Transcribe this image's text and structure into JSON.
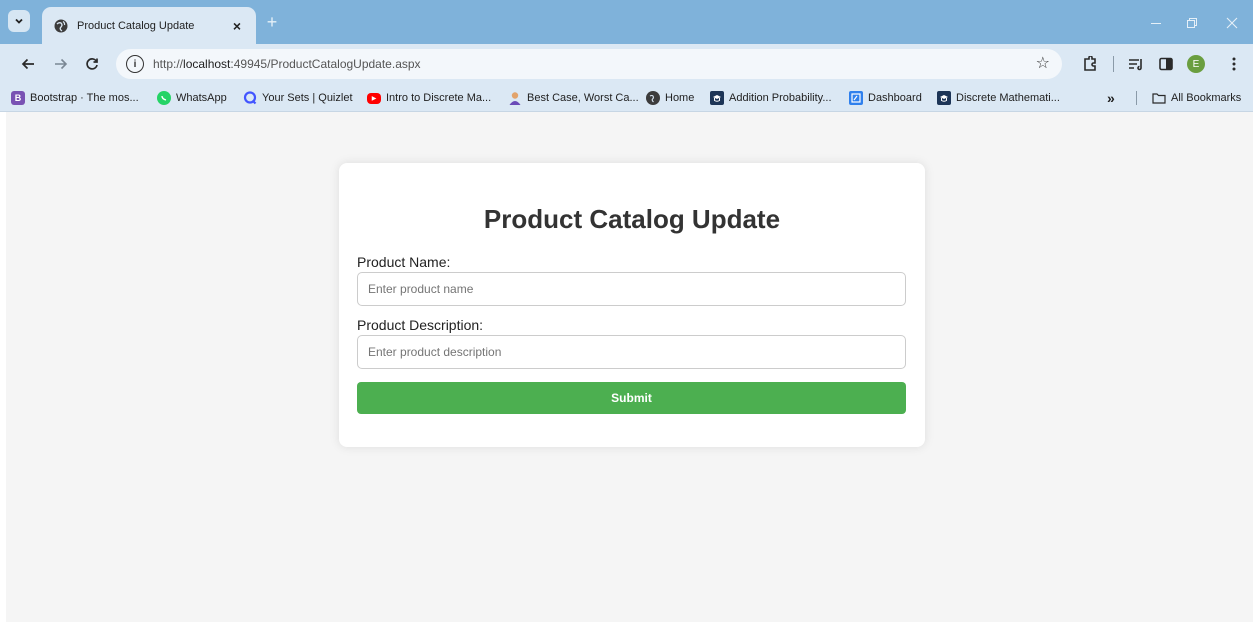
{
  "browser": {
    "tab_title": "Product Catalog Update",
    "tab_close_glyph": "×",
    "new_tab_glyph": "+",
    "url_prefix": "http://",
    "url_host": "localhost",
    "url_rest": ":49945/ProductCatalogUpdate.aspx",
    "profile_initial": "E",
    "profile_color": "#6a9e3f",
    "tabstrip_color": "#7fb2da",
    "toolbar_color": "#dbe8f4"
  },
  "bookmarks": {
    "items": [
      {
        "label": "Bootstrap · The mos...",
        "icon": "bootstrap-icon",
        "glyph": "B",
        "color": "#7952b3"
      },
      {
        "label": "WhatsApp",
        "icon": "whatsapp-icon",
        "glyph": "",
        "color": "#25d366"
      },
      {
        "label": "Your Sets | Quizlet",
        "icon": "quizlet-icon",
        "glyph": "Q",
        "color": "#4255ff"
      },
      {
        "label": "Intro to Discrete Ma...",
        "icon": "youtube-icon",
        "glyph": "▶",
        "color": "#ff0000"
      },
      {
        "label": "Best Case, Worst Ca...",
        "icon": "avatar-icon",
        "glyph": "",
        "color": "#e2a36b"
      },
      {
        "label": "Home",
        "icon": "globe-icon",
        "glyph": "",
        "color": "#3c3c3c"
      },
      {
        "label": "Addition Probability...",
        "icon": "school-icon",
        "glyph": "",
        "color": "#1d3557"
      },
      {
        "label": "Dashboard",
        "icon": "dashboard-icon",
        "glyph": "",
        "color": "#2f80ed"
      },
      {
        "label": "Discrete Mathemati...",
        "icon": "school-icon",
        "glyph": "",
        "color": "#1d3557"
      }
    ],
    "overflow_glyph": "»",
    "all_bookmarks_label": "All Bookmarks"
  },
  "form": {
    "title": "Product Catalog Update",
    "name_label": "Product Name:",
    "name_placeholder": "Enter product name",
    "name_value": "",
    "description_label": "Product Description:",
    "description_placeholder": "Enter product description",
    "description_value": "",
    "submit_label": "Submit",
    "submit_color": "#4caf50"
  }
}
